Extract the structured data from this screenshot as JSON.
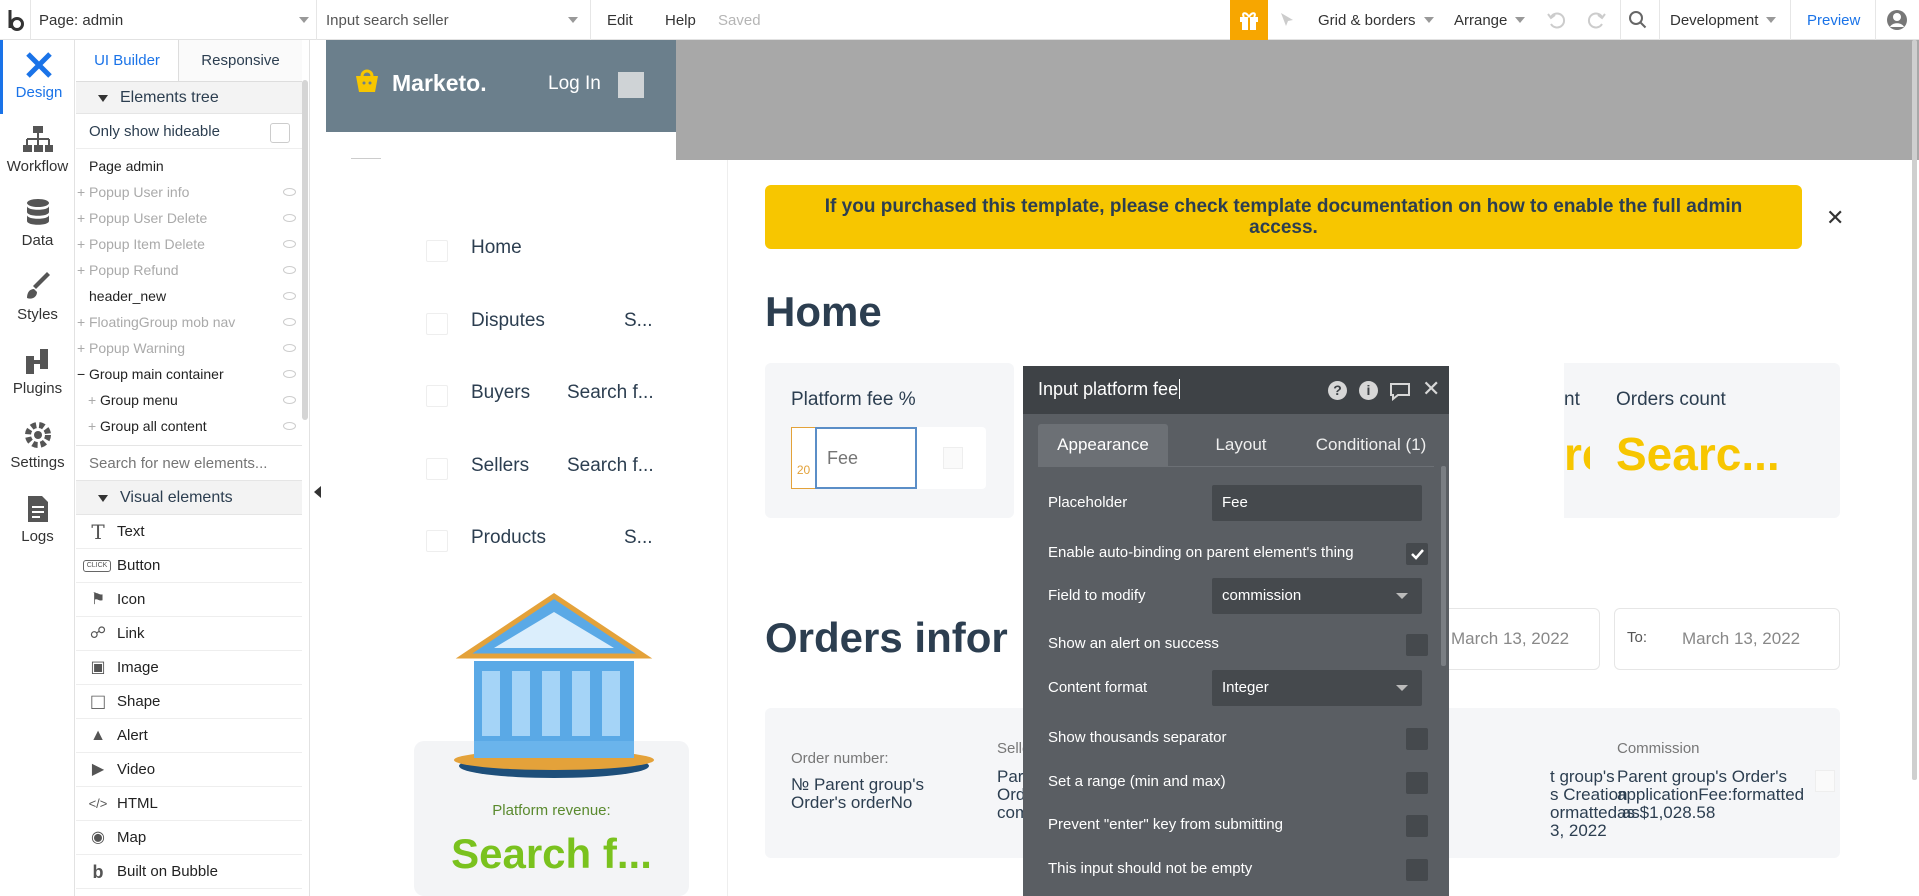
{
  "topbar": {
    "page_label": "Page: admin",
    "search_seller_label": "Input search seller",
    "edit": "Edit",
    "help": "Help",
    "saved": "Saved",
    "grid_borders": "Grid & borders",
    "arrange": "Arrange",
    "development": "Development",
    "preview": "Preview",
    "accent_color": "#f7a600"
  },
  "rail": {
    "items": [
      {
        "label": "Design",
        "icon": "design-icon"
      },
      {
        "label": "Workflow",
        "icon": "workflow-icon"
      },
      {
        "label": "Data",
        "icon": "database-icon"
      },
      {
        "label": "Styles",
        "icon": "brush-icon"
      },
      {
        "label": "Plugins",
        "icon": "plug-icon"
      },
      {
        "label": "Settings",
        "icon": "gear-icon"
      },
      {
        "label": "Logs",
        "icon": "document-icon"
      }
    ]
  },
  "panel": {
    "tab_ui_builder": "UI Builder",
    "tab_responsive": "Responsive",
    "elements_tree": "Elements tree",
    "only_show_hideable": "Only show hideable",
    "tree": [
      {
        "label": "Page admin",
        "prefix": "",
        "muted": false
      },
      {
        "label": "Popup User info",
        "prefix": "+",
        "muted": true
      },
      {
        "label": "Popup User Delete",
        "prefix": "+",
        "muted": true
      },
      {
        "label": "Popup Item Delete",
        "prefix": "+",
        "muted": true
      },
      {
        "label": "Popup Refund",
        "prefix": "+",
        "muted": true
      },
      {
        "label": "header_new",
        "prefix": "",
        "muted": false
      },
      {
        "label": "FloatingGroup mob nav",
        "prefix": "+",
        "muted": true
      },
      {
        "label": "Popup Warning",
        "prefix": "+",
        "muted": true
      },
      {
        "label": "Group main container",
        "prefix": "−",
        "muted": false
      },
      {
        "label": "Group menu",
        "prefix": "+",
        "muted": false
      },
      {
        "label": "Group all content",
        "prefix": "+",
        "muted": false
      }
    ],
    "search_placeholder": "Search for new elements...",
    "visual_elements": "Visual elements",
    "visual_items": [
      {
        "label": "Text",
        "icon": "T"
      },
      {
        "label": "Button",
        "icon": "CLICK"
      },
      {
        "label": "Icon",
        "icon": "⚑"
      },
      {
        "label": "Link",
        "icon": "☍"
      },
      {
        "label": "Image",
        "icon": "▣"
      },
      {
        "label": "Shape",
        "icon": "□"
      },
      {
        "label": "Alert",
        "icon": "▲"
      },
      {
        "label": "Video",
        "icon": "▶"
      },
      {
        "label": "HTML",
        "icon": "</>"
      },
      {
        "label": "Map",
        "icon": "◉"
      },
      {
        "label": "Built on Bubble",
        "icon": "b"
      }
    ]
  },
  "canvas": {
    "brand": "Marketo.",
    "login": "Log In",
    "nav": [
      {
        "label": "Home",
        "value": ""
      },
      {
        "label": "Disputes",
        "value": "S..."
      },
      {
        "label": "Buyers",
        "value": "Search f..."
      },
      {
        "label": "Sellers",
        "value": "Search f..."
      },
      {
        "label": "Products",
        "value": "S..."
      }
    ],
    "platform_revenue_label": "Platform revenue:",
    "platform_revenue_value": "Search f...",
    "banner_text": "If you purchased this template, please check template documentation on how to enable the full admin access.",
    "home_title": "Home",
    "platform_fee_label": "Platform fee %",
    "fee_badge": "20",
    "fee_placeholder": "Fee",
    "card2_label_partial": "nt",
    "card2_value_partial": "rc...",
    "orders_count_label": "Orders count",
    "orders_count_value": "Searc...",
    "orders_info_title": "Orders infor",
    "date_from": "March 13, 2022",
    "to_label": "To:",
    "date_to": "March 13, 2022",
    "order_number_label": "Order number:",
    "order_number_value": "№ Parent group's Order's orderNo",
    "seller_label_partial": "Selle",
    "seller_value_partial": "Par\nOrd\ncom",
    "date_value_partial": "t group's\ns Creation\normatted as\n3, 2022",
    "commission_label": "Commission",
    "commission_value": "Parent group's Order's applicationFee:formatted as $1,028.58"
  },
  "property_editor": {
    "title": "Input platform fee",
    "tabs": [
      "Appearance",
      "Layout",
      "Conditional (1)"
    ],
    "placeholder_label": "Placeholder",
    "placeholder_value": "Fee",
    "autobinding_label": "Enable auto-binding on parent element's thing",
    "field_to_modify_label": "Field to modify",
    "field_to_modify_value": "commission",
    "show_alert_label": "Show an alert on success",
    "content_format_label": "Content format",
    "content_format_value": "Integer",
    "thousands_label": "Show thousands separator",
    "range_label": "Set a range (min and max)",
    "prevent_enter_label": "Prevent \"enter\" key from submitting",
    "not_empty_label": "This input should not be empty"
  }
}
